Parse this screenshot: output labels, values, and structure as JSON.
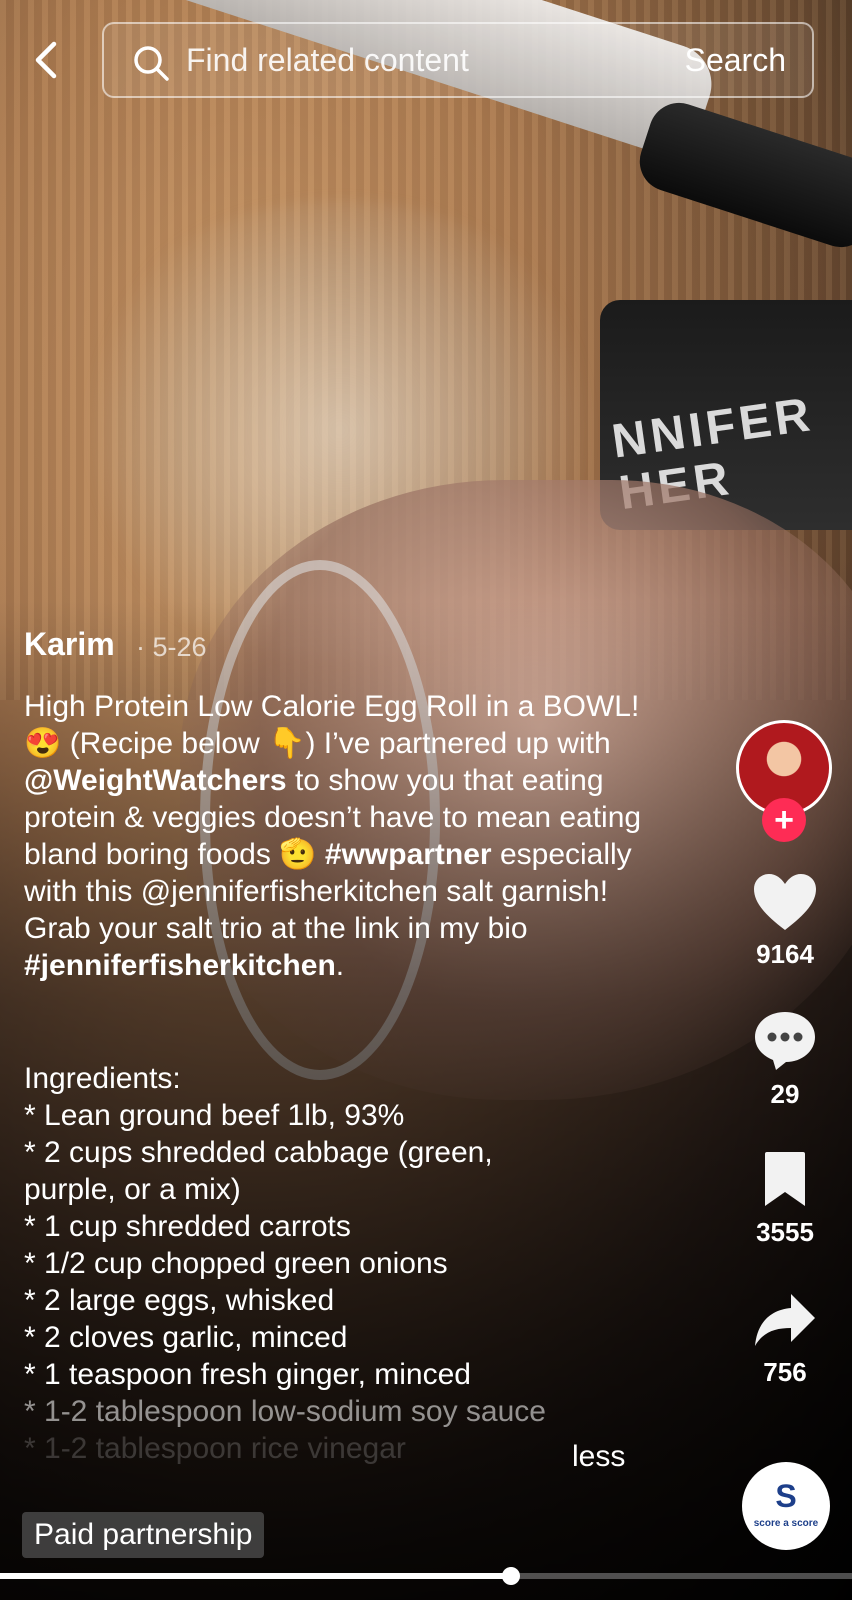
{
  "search": {
    "placeholder": "Find related content",
    "button_label": "Search"
  },
  "post": {
    "author": "Karim",
    "date": "· 5-26",
    "caption": {
      "t1": "High Protein Low Calorie Egg Roll in a BOWL! 😍 (Recipe below 👇) I’ve partnered up with ",
      "mention": "@WeightWatchers",
      "t2": " to show you that eating protein & veggies doesn’t have to mean eating bland boring foods 🫡 ",
      "hashtag1": "#wwpartner",
      "t3": " especially with this @jenniferfisherkitchen salt garnish! Grab your salt trio at the link in my bio ",
      "hashtag2": "#jenniferfisherkitchen",
      "t4": "."
    },
    "ingredients_heading": "Ingredients:",
    "ingredients": [
      "* Lean ground beef 1lb, 93%",
      "* 2 cups shredded cabbage (green,",
      "purple, or a mix)",
      "* 1 cup shredded carrots",
      "* 1/2 cup chopped green onions",
      "* 2 large eggs, whisked",
      "* 2 cloves garlic, minced",
      "* 1 teaspoon fresh ginger, minced",
      "* 1-2 tablespoon low-sodium soy sauce",
      "* 1-2 tablespoon rice vinegar"
    ],
    "less_label": "less",
    "paid_label": "Paid partnership"
  },
  "video_text": {
    "jar_label": "NNIFER\nHER"
  },
  "rail": {
    "follow_symbol": "+",
    "likes": "9164",
    "comments": "29",
    "saves": "3555",
    "shares": "756"
  },
  "sound": {
    "logo_letter": "S",
    "logo_text": "score a score"
  },
  "playback": {
    "progress": 0.6
  },
  "colors": {
    "follow": "#fe2c55",
    "logo": "#1d3f8a"
  }
}
